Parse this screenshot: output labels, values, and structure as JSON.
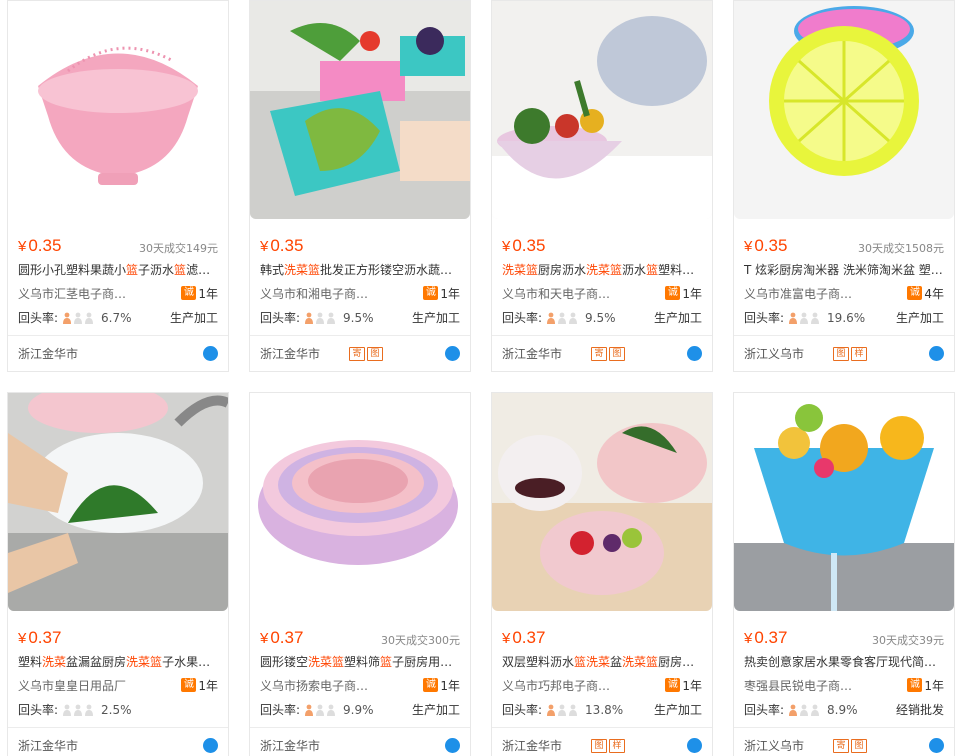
{
  "products": [
    {
      "price": "0.35",
      "deal": "30天成交149元",
      "title": [
        [
          "圆形小孔塑料果蔬小",
          ""
        ],
        [
          "篮",
          "hl"
        ],
        [
          "子沥水",
          ""
        ],
        [
          "篮",
          "hl"
        ],
        [
          "滤…",
          ""
        ]
      ],
      "shop": "义乌市汇茎电子商…",
      "years": "1年",
      "rate": "6.7%",
      "biz": "生产加工",
      "location": "浙江金华市",
      "tags": []
    },
    {
      "price": "0.35",
      "deal": "",
      "title": [
        [
          "韩式",
          ""
        ],
        [
          "洗菜篮",
          "hl"
        ],
        [
          "批发正方形镂空沥水蔬…",
          ""
        ]
      ],
      "shop": "义乌市和湘电子商…",
      "years": "1年",
      "rate": "9.5%",
      "biz": "生产加工",
      "location": "浙江金华市",
      "tags": [
        "寄",
        "图"
      ]
    },
    {
      "price": "0.35",
      "deal": "",
      "title": [
        [
          "洗菜篮",
          "hl"
        ],
        [
          "厨房沥水",
          ""
        ],
        [
          "洗菜篮",
          "hl"
        ],
        [
          "沥水",
          ""
        ],
        [
          "篮",
          "hl"
        ],
        [
          "塑料…",
          ""
        ]
      ],
      "shop": "义乌市和天电子商…",
      "years": "1年",
      "rate": "9.5%",
      "biz": "生产加工",
      "location": "浙江金华市",
      "tags": [
        "寄",
        "图"
      ]
    },
    {
      "price": "0.35",
      "deal": "30天成交1508元",
      "title": [
        [
          "T 炫彩厨房淘米器 洗米筛淘米盆 塑…",
          ""
        ]
      ],
      "shop": "义乌市准富电子商…",
      "years": "4年",
      "rate": "19.6%",
      "biz": "生产加工",
      "location": "浙江义乌市",
      "tags": [
        "图",
        "样"
      ]
    },
    {
      "price": "0.37",
      "deal": "",
      "title": [
        [
          "塑料",
          ""
        ],
        [
          "洗菜",
          "hl"
        ],
        [
          "盆漏盆厨房",
          ""
        ],
        [
          "洗菜篮",
          "hl"
        ],
        [
          "子水果…",
          ""
        ]
      ],
      "shop": "义乌市皇皇日用品厂",
      "years": "1年",
      "rate": "2.5%",
      "biz": "",
      "location": "浙江金华市",
      "tags": []
    },
    {
      "price": "0.37",
      "deal": "30天成交300元",
      "title": [
        [
          "圆形镂空",
          ""
        ],
        [
          "洗菜篮",
          "hl"
        ],
        [
          "塑料筛",
          ""
        ],
        [
          "篮",
          "hl"
        ],
        [
          "子厨房用…",
          ""
        ]
      ],
      "shop": "义乌市扬索电子商…",
      "years": "1年",
      "rate": "9.9%",
      "biz": "生产加工",
      "location": "浙江金华市",
      "tags": []
    },
    {
      "price": "0.37",
      "deal": "",
      "title": [
        [
          "双层塑料沥水",
          ""
        ],
        [
          "篮洗菜",
          "hl"
        ],
        [
          "盆",
          ""
        ],
        [
          "洗菜篮",
          "hl"
        ],
        [
          "厨房…",
          ""
        ]
      ],
      "shop": "义乌市巧邦电子商…",
      "years": "1年",
      "rate": "13.8%",
      "biz": "生产加工",
      "location": "浙江金华市",
      "tags": [
        "图",
        "样"
      ]
    },
    {
      "price": "0.37",
      "deal": "30天成交39元",
      "title": [
        [
          "热卖创意家居水果零食客厅现代简…",
          ""
        ]
      ],
      "shop": "枣强县民锐电子商…",
      "years": "1年",
      "rate": "8.9%",
      "biz": "经销批发",
      "location": "浙江义乌市",
      "tags": [
        "寄",
        "图"
      ]
    }
  ],
  "labels": {
    "currency": "¥",
    "rate_label": "回头率:",
    "cheng_icon": "诚"
  },
  "colors": {
    "price": "#ff4400",
    "accent": "#ff7800",
    "wangwang": "#1e90e8"
  },
  "icons": [
    "wangwang-chat-icon",
    "cheng-xin-icon",
    "repeat-buyer-figure-icon"
  ]
}
